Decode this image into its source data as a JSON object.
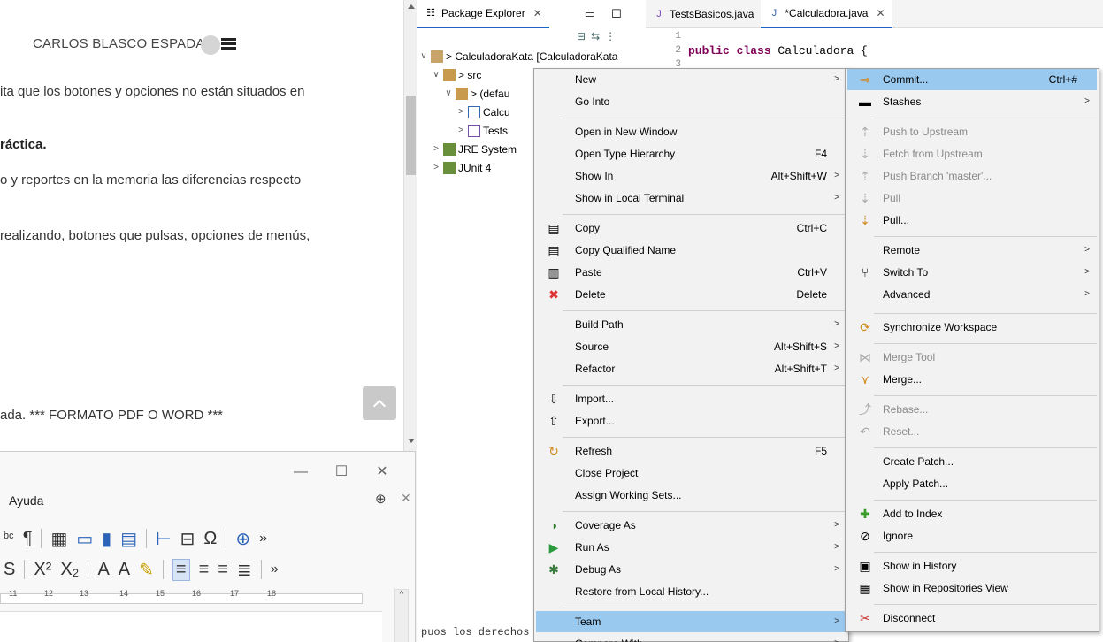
{
  "browser": {
    "user_name": "CARLOS BLASCO ESPADA",
    "lines": [
      "ita que los botones y opciones no están situados en",
      "ráctica.",
      "o y reportes en la memoria las diferencias respecto",
      "realizando, botones que pulsas, opciones de menús,",
      "ada. *** FORMATO PDF O WORD ***"
    ]
  },
  "writer": {
    "menu_label": "Ayuda",
    "ruler_labels": [
      "11",
      "12",
      "13",
      "14",
      "15",
      "16",
      "17",
      "18"
    ]
  },
  "eclipse": {
    "package_explorer_tab": "Package Explorer",
    "editor_tabs": [
      "TestsBasicos.java",
      "*Calculadora.java"
    ],
    "tree": {
      "project": "> CalculadoraKata [CalculadoraKata",
      "src": "> src",
      "default_pkg": "> (defau",
      "file1": "Calcu",
      "file2": "Tests",
      "jre": "JRE System",
      "junit": "JUnit 4"
    },
    "code": {
      "line_numbers": [
        "1",
        "2",
        "3"
      ],
      "line2_kw": "public class",
      "line2_rest": " Calculadora {"
    },
    "bottom_code": "puos los derechos reservados."
  },
  "context_menu": [
    {
      "label": "New",
      "shortcut": "",
      "submenu": true,
      "icon": ""
    },
    {
      "label": "Go Into",
      "shortcut": "",
      "submenu": false,
      "icon": ""
    },
    {
      "label": "Open in New Window",
      "shortcut": "",
      "submenu": false,
      "icon": ""
    },
    {
      "label": "Open Type Hierarchy",
      "shortcut": "F4",
      "submenu": false,
      "icon": ""
    },
    {
      "label": "Show In",
      "shortcut": "Alt+Shift+W",
      "submenu": true,
      "icon": ""
    },
    {
      "label": "Show in Local Terminal",
      "shortcut": "",
      "submenu": true,
      "icon": ""
    },
    {
      "label": "Copy",
      "shortcut": "Ctrl+C",
      "submenu": false,
      "icon": "copy-icon"
    },
    {
      "label": "Copy Qualified Name",
      "shortcut": "",
      "submenu": false,
      "icon": "copy-qualified-icon"
    },
    {
      "label": "Paste",
      "shortcut": "Ctrl+V",
      "submenu": false,
      "icon": "paste-icon"
    },
    {
      "label": "Delete",
      "shortcut": "Delete",
      "submenu": false,
      "icon": "delete-icon"
    },
    {
      "label": "Build Path",
      "shortcut": "",
      "submenu": true,
      "icon": ""
    },
    {
      "label": "Source",
      "shortcut": "Alt+Shift+S",
      "submenu": true,
      "icon": ""
    },
    {
      "label": "Refactor",
      "shortcut": "Alt+Shift+T",
      "submenu": true,
      "icon": ""
    },
    {
      "label": "Import...",
      "shortcut": "",
      "submenu": false,
      "icon": "import-icon"
    },
    {
      "label": "Export...",
      "shortcut": "",
      "submenu": false,
      "icon": "export-icon"
    },
    {
      "label": "Refresh",
      "shortcut": "F5",
      "submenu": false,
      "icon": "refresh-icon"
    },
    {
      "label": "Close Project",
      "shortcut": "",
      "submenu": false,
      "icon": ""
    },
    {
      "label": "Assign Working Sets...",
      "shortcut": "",
      "submenu": false,
      "icon": ""
    },
    {
      "label": "Coverage As",
      "shortcut": "",
      "submenu": true,
      "icon": "coverage-icon"
    },
    {
      "label": "Run As",
      "shortcut": "",
      "submenu": true,
      "icon": "run-icon"
    },
    {
      "label": "Debug As",
      "shortcut": "",
      "submenu": true,
      "icon": "debug-icon"
    },
    {
      "label": "Restore from Local History...",
      "shortcut": "",
      "submenu": false,
      "icon": ""
    },
    {
      "label": "Team",
      "shortcut": "",
      "submenu": true,
      "icon": ""
    },
    {
      "label": "Compare With",
      "shortcut": "",
      "submenu": true,
      "icon": ""
    }
  ],
  "team_menu": [
    {
      "label": "Commit...",
      "shortcut": "Ctrl+#",
      "submenu": false,
      "icon": "commit-icon",
      "disabled": false
    },
    {
      "label": "Stashes",
      "shortcut": "",
      "submenu": true,
      "icon": "stashes-icon",
      "disabled": false
    },
    {
      "label": "Push to Upstream",
      "shortcut": "",
      "submenu": false,
      "icon": "push-icon",
      "disabled": true
    },
    {
      "label": "Fetch from Upstream",
      "shortcut": "",
      "submenu": false,
      "icon": "fetch-icon",
      "disabled": true
    },
    {
      "label": "Push Branch 'master'...",
      "shortcut": "",
      "submenu": false,
      "icon": "push-branch-icon",
      "disabled": true
    },
    {
      "label": "Pull",
      "shortcut": "",
      "submenu": false,
      "icon": "pull-icon",
      "disabled": true
    },
    {
      "label": "Pull...",
      "shortcut": "",
      "submenu": false,
      "icon": "pull-dialog-icon",
      "disabled": false
    },
    {
      "label": "Remote",
      "shortcut": "",
      "submenu": true,
      "icon": "",
      "disabled": false
    },
    {
      "label": "Switch To",
      "shortcut": "",
      "submenu": true,
      "icon": "switch-icon",
      "disabled": false
    },
    {
      "label": "Advanced",
      "shortcut": "",
      "submenu": true,
      "icon": "",
      "disabled": false
    },
    {
      "label": "Synchronize Workspace",
      "shortcut": "",
      "submenu": false,
      "icon": "synchronize-icon",
      "disabled": false
    },
    {
      "label": "Merge Tool",
      "shortcut": "",
      "submenu": false,
      "icon": "merge-tool-icon",
      "disabled": true
    },
    {
      "label": "Merge...",
      "shortcut": "",
      "submenu": false,
      "icon": "merge-icon",
      "disabled": false
    },
    {
      "label": "Rebase...",
      "shortcut": "",
      "submenu": false,
      "icon": "rebase-icon",
      "disabled": true
    },
    {
      "label": "Reset...",
      "shortcut": "",
      "submenu": false,
      "icon": "reset-icon",
      "disabled": true
    },
    {
      "label": "Create Patch...",
      "shortcut": "",
      "submenu": false,
      "icon": "",
      "disabled": false
    },
    {
      "label": "Apply Patch...",
      "shortcut": "",
      "submenu": false,
      "icon": "",
      "disabled": false
    },
    {
      "label": "Add to Index",
      "shortcut": "",
      "submenu": false,
      "icon": "add-index-icon",
      "disabled": false
    },
    {
      "label": "Ignore",
      "shortcut": "",
      "submenu": false,
      "icon": "ignore-icon",
      "disabled": false
    },
    {
      "label": "Show in History",
      "shortcut": "",
      "submenu": false,
      "icon": "history-icon",
      "disabled": false
    },
    {
      "label": "Show in Repositories View",
      "shortcut": "",
      "submenu": false,
      "icon": "repositories-icon",
      "disabled": false
    },
    {
      "label": "Disconnect",
      "shortcut": "",
      "submenu": false,
      "icon": "disconnect-icon",
      "disabled": false
    }
  ],
  "colors": {
    "highlight": "#99c9ef",
    "menu_bg": "#f2f2f2",
    "keyword": "#7f0055"
  }
}
